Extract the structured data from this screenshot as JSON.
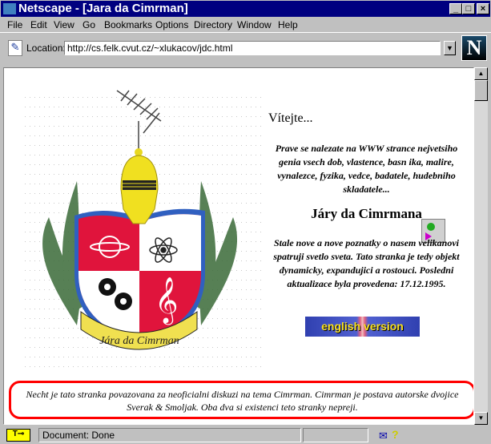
{
  "window": {
    "title": "Netscape - [Jara da Cimrman]"
  },
  "menu": [
    "File",
    "Edit",
    "View",
    "Go",
    "Bookmarks",
    "Options",
    "Directory",
    "Window",
    "Help"
  ],
  "location": {
    "label": "Location:",
    "url": "http://cs.felk.cvut.cz/~xlukacov/jdc.html"
  },
  "logo": "N",
  "page": {
    "welcome": "Vítejte...",
    "intro": "Prave se nalezate na WWW strance nejvetsiho genia vsech dob, vlastence, basn ika, malire, vynalezce, fyzika, vedce, badatele, hudebniho skladatele...",
    "name": "Járy da Cimrmana",
    "update": "Stale nove a nove poznatky o nasem velikanovi spatruji svetlo sveta. Tato stranka je tedy objekt dynamicky, expandujici a rostouci. Posledni aktualizace byla provedena: 17.12.1995.",
    "english_button": "english version",
    "crest_banner": "Jára da Cimrman",
    "disclaimer": "Necht je tato stranka povazovana za neoficialni diskuzi na tema Cimrman. Cimrman je postava autorske dvojice Sverak & Smoljak. Oba dva si existenci teto stranky nepreji."
  },
  "status": {
    "text": "Document: Done"
  },
  "colors": {
    "titlebar": "#000080",
    "shield_red": "#e0143c",
    "helmet": "#f0e020",
    "disclaimer_border": "#ff0000"
  }
}
